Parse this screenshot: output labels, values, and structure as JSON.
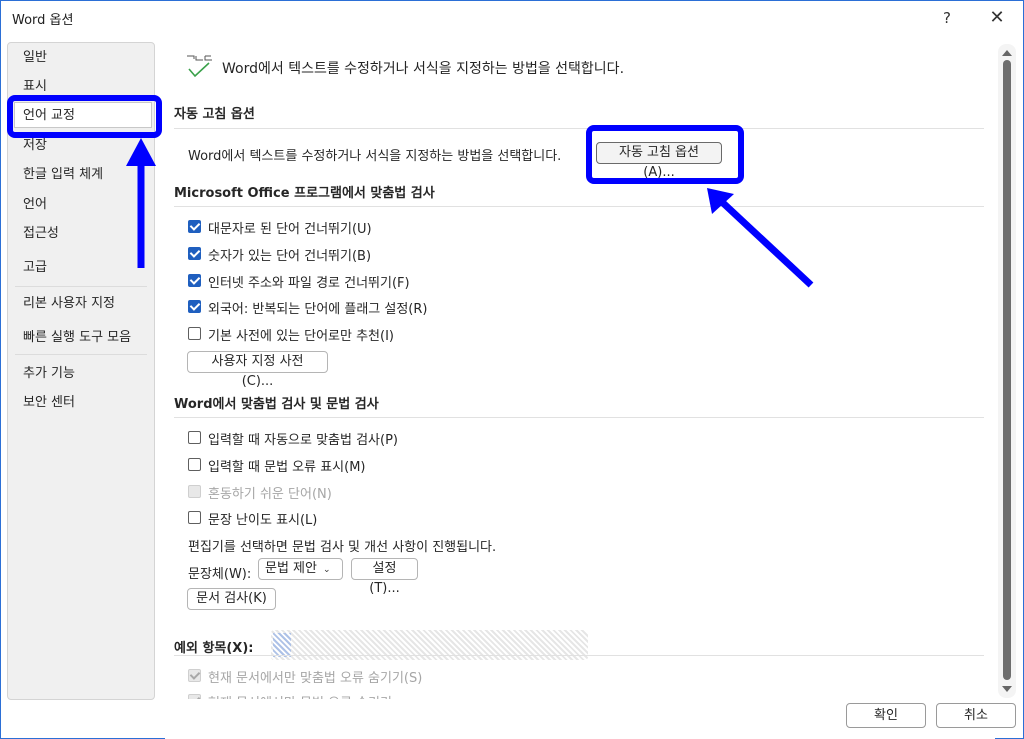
{
  "window": {
    "title": "Word 옵션",
    "help_label": "?",
    "close_label": "✕"
  },
  "sidebar": {
    "items": [
      {
        "label": "일반",
        "selected": false
      },
      {
        "label": "표시",
        "selected": false
      },
      {
        "label": "언어 교정",
        "selected": true
      },
      {
        "label": "저장",
        "selected": false
      },
      {
        "label": "한글 입력 체계",
        "selected": false
      },
      {
        "label": "언어",
        "selected": false
      },
      {
        "label": "접근성",
        "selected": false
      },
      {
        "label": "고급",
        "selected": false
      },
      {
        "label": "리본 사용자 지정",
        "selected": false
      },
      {
        "label": "빠른 실행 도구 모음",
        "selected": false
      },
      {
        "label": "추가 기능",
        "selected": false
      },
      {
        "label": "보안 센터",
        "selected": false
      }
    ]
  },
  "main": {
    "intro": {
      "icon": "proofing-check-icon",
      "text": "Word에서 텍스트를 수정하거나 서식을 지정하는 방법을 선택합니다."
    },
    "autocorrect_section": {
      "heading": "자동 고침 옵션",
      "description": "Word에서 텍스트를 수정하거나 서식을 지정하는 방법을 선택합니다.",
      "button_label": "자동 고침 옵션(A)..."
    },
    "office_spelling_section": {
      "heading": "Microsoft Office 프로그램에서 맞춤법 검사",
      "options": [
        {
          "label": "대문자로 된 단어 건너뛰기(U)",
          "checked": true,
          "disabled": false
        },
        {
          "label": "숫자가 있는 단어 건너뛰기(B)",
          "checked": true,
          "disabled": false
        },
        {
          "label": "인터넷 주소와 파일 경로 건너뛰기(F)",
          "checked": true,
          "disabled": false
        },
        {
          "label": "외국어: 반복되는 단어에 플래그 설정(R)",
          "checked": true,
          "disabled": false
        },
        {
          "label": "기본 사전에 있는 단어로만 추천(I)",
          "checked": false,
          "disabled": false
        }
      ],
      "custom_dict_button": "사용자 지정 사전(C)..."
    },
    "word_spelling_section": {
      "heading": "Word에서 맞춤법 검사 및 문법 검사",
      "options": [
        {
          "label": "입력할 때 자동으로 맞춤법 검사(P)",
          "checked": false,
          "disabled": false
        },
        {
          "label": "입력할 때 문법 오류 표시(M)",
          "checked": false,
          "disabled": false
        },
        {
          "label": "혼동하기 쉬운 단어(N)",
          "checked": false,
          "disabled": true
        },
        {
          "label": "문장 난이도 표시(L)",
          "checked": false,
          "disabled": false
        }
      ],
      "editor_note": "편집기를 선택하면 문법 검사 및 개선 사항이 진행됩니다.",
      "style_label": "문장체(W):",
      "style_value": "문법 제안",
      "settings_button": "설정(T)...",
      "check_document_button": "문서 검사(K)"
    },
    "exceptions_section": {
      "heading": "예외 항목(X):",
      "options": [
        {
          "label": "현재 문서에서만 맞춤법 오류 숨기기(S)",
          "checked": true,
          "disabled": true
        },
        {
          "label": "현재 문서에서만 문법 오류 숨기기",
          "checked": true,
          "disabled": true
        }
      ]
    }
  },
  "footer": {
    "ok_label": "확인",
    "cancel_label": "취소"
  },
  "annotations": {
    "color": "#0000ff"
  }
}
